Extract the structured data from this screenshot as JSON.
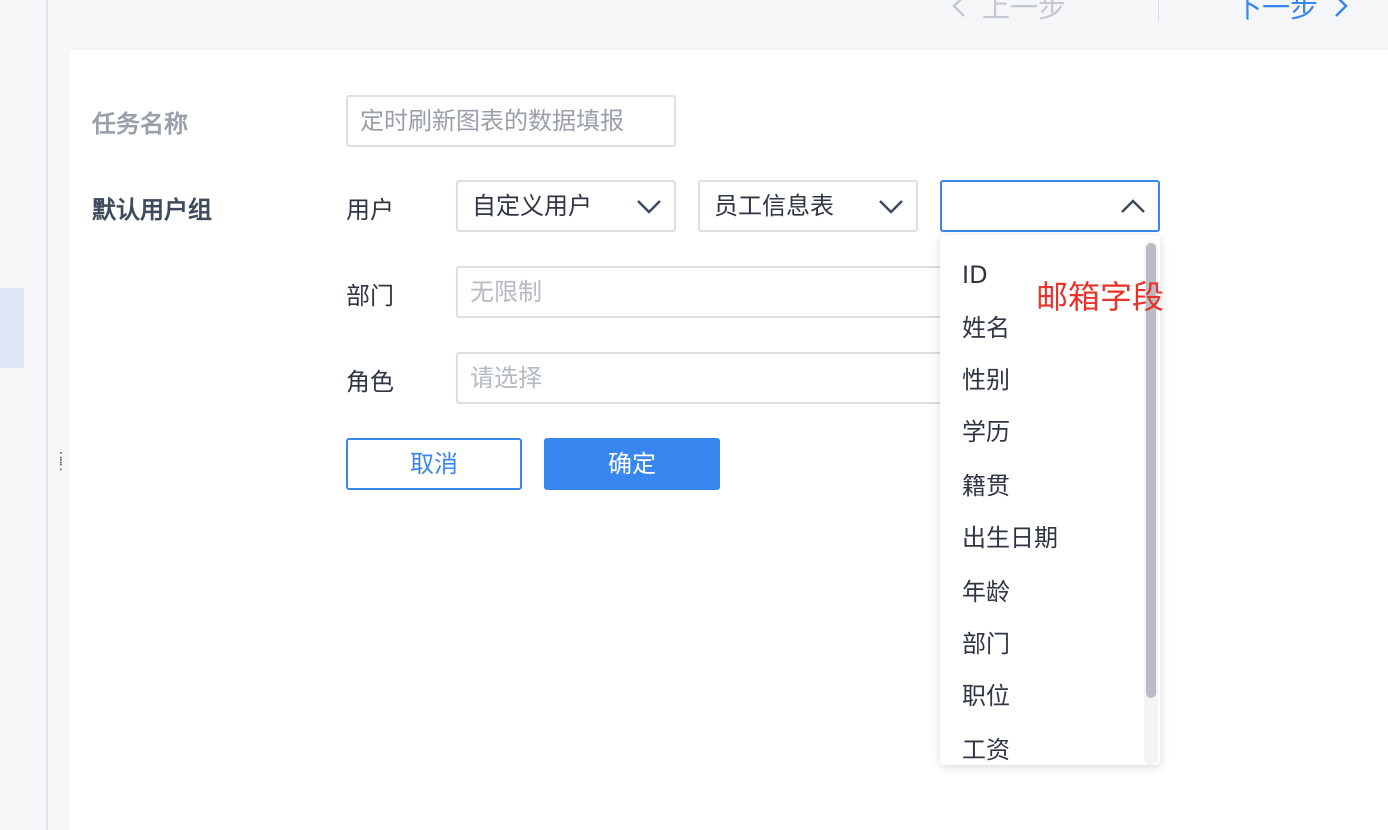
{
  "nav": {
    "prev_label": "上一步",
    "next_label": "下一步"
  },
  "form": {
    "task_name_label": "任务名称",
    "task_name_value": "定时刷新图表的数据填报",
    "default_group_label": "默认用户组",
    "user_label": "用户",
    "user_type_value": "自定义用户",
    "table_value": "员工信息表",
    "field_value": "",
    "dept_label": "部门",
    "dept_placeholder": "无限制",
    "role_label": "角色",
    "role_placeholder": "请选择",
    "cancel_label": "取消",
    "confirm_label": "确定"
  },
  "dropdown": {
    "options": [
      "ID",
      "姓名",
      "性别",
      "学历",
      "籍贯",
      "出生日期",
      "年龄",
      "部门",
      "职位",
      "工资"
    ]
  },
  "annotation": "邮箱字段",
  "colors": {
    "accent": "#3a86f0",
    "annotation": "#e8322a"
  }
}
